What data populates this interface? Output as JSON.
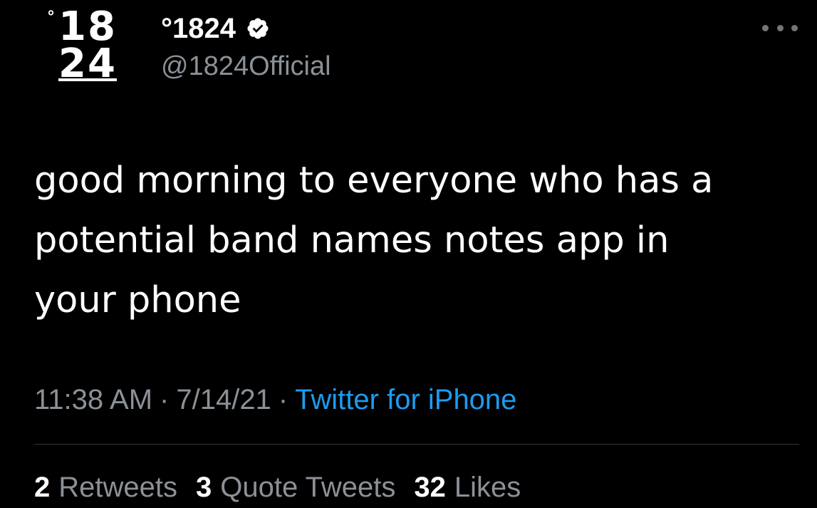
{
  "tweet": {
    "avatar": {
      "degree_mark": "°",
      "line1": "18",
      "line2": "24"
    },
    "display_name": "°1824",
    "handle": "@1824Official",
    "text": "good morning to everyone who has a\npotential band names notes app in\nyour phone",
    "time": "11:38 AM",
    "separator": "·",
    "date": "7/14/21",
    "source": "Twitter for iPhone",
    "stats": {
      "retweets_count": "2",
      "retweets_label": "Retweets",
      "quotes_count": "3",
      "quotes_label": "Quote Tweets",
      "likes_count": "32",
      "likes_label": "Likes"
    }
  },
  "icons": {
    "verified": "verified-badge-icon",
    "more": "more-options-icon"
  },
  "colors": {
    "background": "#000000",
    "text_primary": "#ffffff",
    "text_secondary": "#8b9197",
    "link": "#1d9bf0",
    "divider": "#2f3336"
  }
}
